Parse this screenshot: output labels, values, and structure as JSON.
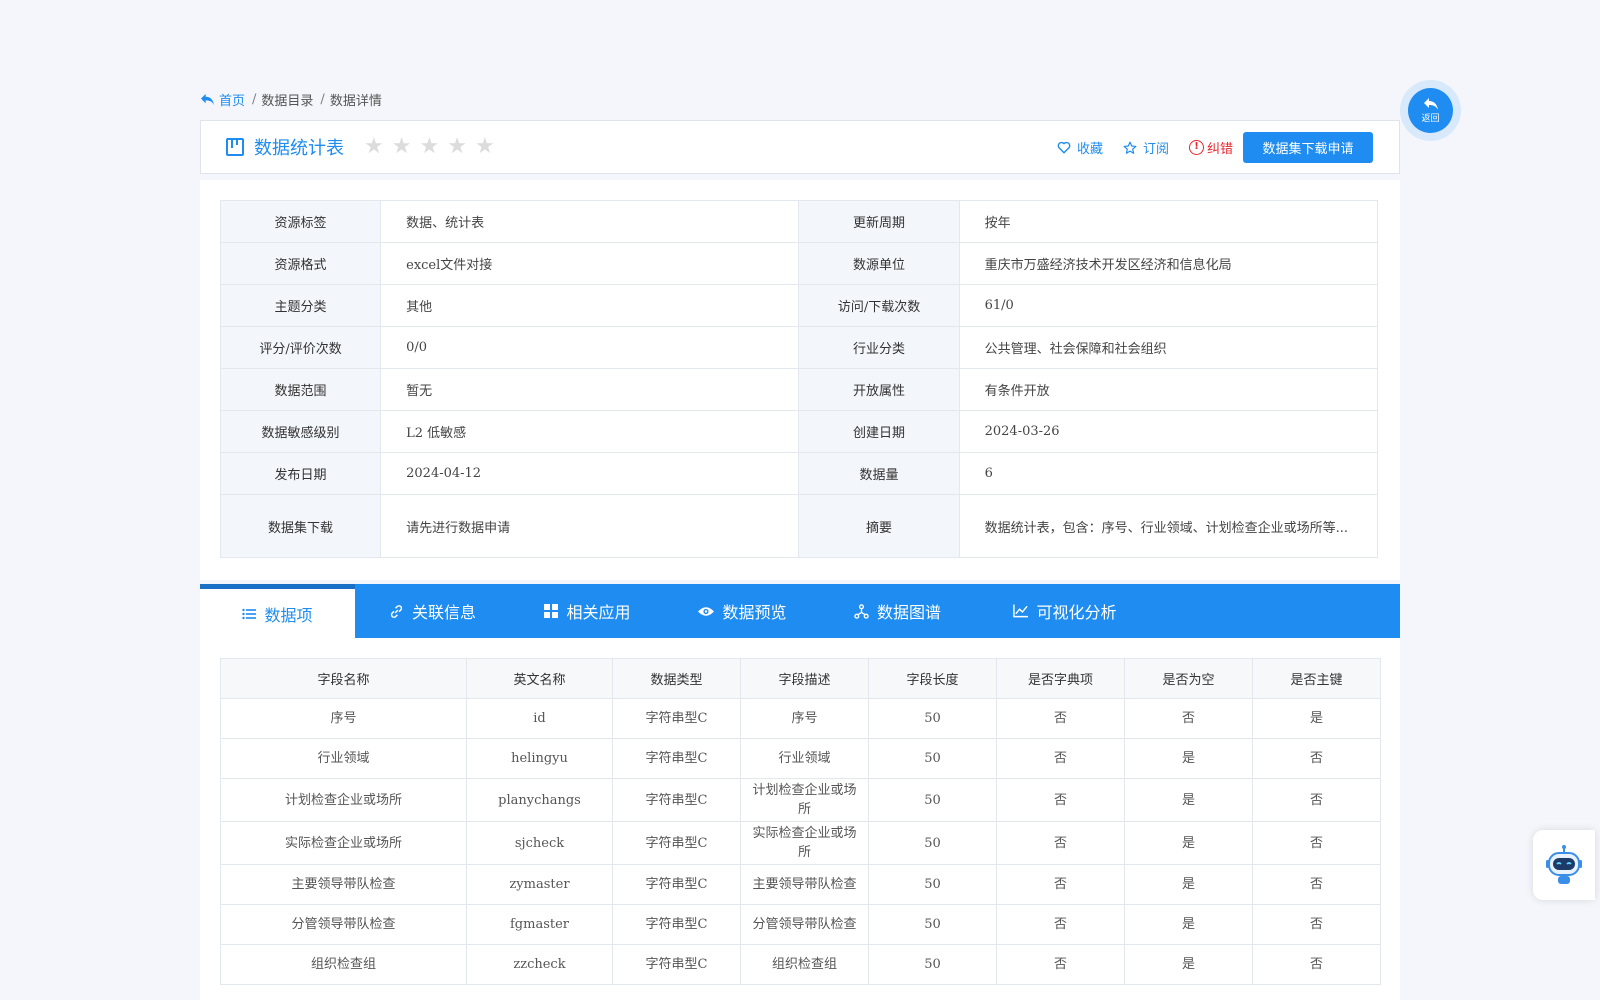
{
  "breadcrumb": {
    "home": "首页",
    "items": [
      "数据目录",
      "数据详情"
    ],
    "separator": "/"
  },
  "title": {
    "text": "数据统计表",
    "rating_stars": 5,
    "rating_filled": 0,
    "actions": {
      "favorite": "收藏",
      "subscribe": "订阅",
      "report_error": "纠错",
      "download_apply": "数据集下载申请"
    }
  },
  "info": [
    [
      "资源标签",
      "数据、统计表",
      "更新周期",
      "按年"
    ],
    [
      "资源格式",
      "excel文件对接",
      "数源单位",
      "重庆市万盛经济技术开发区经济和信息化局"
    ],
    [
      "主题分类",
      "其他",
      "访问/下载次数",
      "61/0"
    ],
    [
      "评分/评价次数",
      "0/0",
      "行业分类",
      "公共管理、社会保障和社会组织"
    ],
    [
      "数据范围",
      "暂无",
      "开放属性",
      "有条件开放"
    ],
    [
      "数据敏感级别",
      "L2 低敏感",
      "创建日期",
      "2024-03-26"
    ],
    [
      "发布日期",
      "2024-04-12",
      "数据量",
      "6"
    ],
    [
      "数据集下载",
      "请先进行数据申请",
      "摘要",
      "数据统计表，包含：序号、行业领域、计划检查企业或场所等..."
    ]
  ],
  "tabs": [
    {
      "label": "数据项",
      "icon": "list-icon",
      "active": true
    },
    {
      "label": "关联信息",
      "icon": "link-icon",
      "active": false
    },
    {
      "label": "相关应用",
      "icon": "grid-icon",
      "active": false
    },
    {
      "label": "数据预览",
      "icon": "eye-icon",
      "active": false
    },
    {
      "label": "数据图谱",
      "icon": "graph-icon",
      "active": false
    },
    {
      "label": "可视化分析",
      "icon": "chart-line-icon",
      "active": false
    }
  ],
  "fields": {
    "headers": [
      "字段名称",
      "英文名称",
      "数据类型",
      "字段描述",
      "字段长度",
      "是否字典项",
      "是否为空",
      "是否主键"
    ],
    "rows": [
      [
        "序号",
        "id",
        "字符串型C",
        "序号",
        "50",
        "否",
        "否",
        "是"
      ],
      [
        "行业领域",
        "helingyu",
        "字符串型C",
        "行业领域",
        "50",
        "否",
        "是",
        "否"
      ],
      [
        "计划检查企业或场所",
        "planychangs",
        "字符串型C",
        "计划检查企业或场所",
        "50",
        "否",
        "是",
        "否"
      ],
      [
        "实际检查企业或场所",
        "sjcheck",
        "字符串型C",
        "实际检查企业或场所",
        "50",
        "否",
        "是",
        "否"
      ],
      [
        "主要领导带队检查",
        "zymaster",
        "字符串型C",
        "主要领导带队检查",
        "50",
        "否",
        "是",
        "否"
      ],
      [
        "分管领导带队检查",
        "fgmaster",
        "字符串型C",
        "分管领导带队检查",
        "50",
        "否",
        "是",
        "否"
      ],
      [
        "组织检查组",
        "zzcheck",
        "字符串型C",
        "组织检查组",
        "50",
        "否",
        "是",
        "否"
      ]
    ]
  },
  "floating": {
    "back_label": "返回",
    "assistant_icon": "robot-icon"
  },
  "colors": {
    "primary": "#1e8cf0",
    "danger": "#e6262e",
    "tab_active_border": "#1a70c4"
  }
}
